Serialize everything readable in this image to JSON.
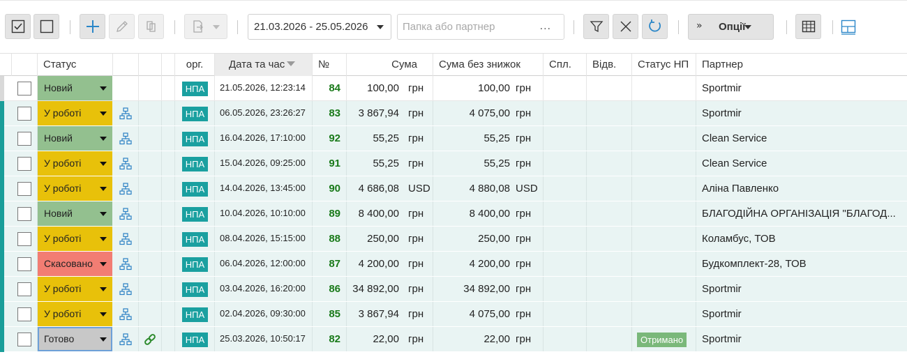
{
  "toolbar": {
    "select_all_icon": "checked-box-icon",
    "deselect_icon": "empty-box-icon",
    "add_icon": "plus-icon",
    "edit_icon": "pencil-icon",
    "copy_icon": "copy-icon",
    "export_icon": "document-export-icon",
    "date_range": "21.03.2026 - 25.05.2026",
    "partner_placeholder": "Папка або партнер",
    "partner_dots": "...",
    "filter_icon": "filter-icon",
    "clear_icon": "close-icon",
    "refresh_icon": "refresh-icon",
    "options_chevrons": "»",
    "options_label": "Опції",
    "table_icon": "table-icon",
    "layout_icon": "layout-icon"
  },
  "columns": {
    "status": "Статус",
    "org": "орг.",
    "datetime": "Дата та час",
    "number": "№",
    "sum": "Сума",
    "sum_no_discount": "Сума без знижок",
    "paid": "Спл.",
    "shipped": "Відв.",
    "np_status": "Статус НП",
    "partner": "Партнер"
  },
  "colors": {
    "new": "#93c08f",
    "in_work": "#e8c10a",
    "cancelled": "#f27d73",
    "done": "#c8c8c8",
    "accent": "#1a9e9a",
    "number": "#1a7a1a"
  },
  "rows": [
    {
      "status": "Новий",
      "status_key": "new",
      "has_tree": false,
      "has_link": false,
      "org": "НПА",
      "datetime": "21.05.2026, 12:23:14",
      "number": "84",
      "sum": "100,00",
      "sum_cur": "грн",
      "sum_nd": "100,00",
      "sum_nd_cur": "грн",
      "np_status": "",
      "partner": "Sportmir"
    },
    {
      "status": "У роботі",
      "status_key": "in_work",
      "has_tree": true,
      "has_link": false,
      "org": "НПА",
      "datetime": "06.05.2026, 23:26:27",
      "number": "83",
      "sum": "3 867,94",
      "sum_cur": "грн",
      "sum_nd": "4 075,00",
      "sum_nd_cur": "грн",
      "np_status": "",
      "partner": "Sportmir"
    },
    {
      "status": "Новий",
      "status_key": "new",
      "has_tree": true,
      "has_link": false,
      "org": "НПА",
      "datetime": "16.04.2026, 17:10:00",
      "number": "92",
      "sum": "55,25",
      "sum_cur": "грн",
      "sum_nd": "55,25",
      "sum_nd_cur": "грн",
      "np_status": "",
      "partner": "Clean Service"
    },
    {
      "status": "У роботі",
      "status_key": "in_work",
      "has_tree": true,
      "has_link": false,
      "org": "НПА",
      "datetime": "15.04.2026, 09:25:00",
      "number": "91",
      "sum": "55,25",
      "sum_cur": "грн",
      "sum_nd": "55,25",
      "sum_nd_cur": "грн",
      "np_status": "",
      "partner": "Clean Service"
    },
    {
      "status": "У роботі",
      "status_key": "in_work",
      "has_tree": true,
      "has_link": false,
      "org": "НПА",
      "datetime": "14.04.2026, 13:45:00",
      "number": "90",
      "sum": "4 686,08",
      "sum_cur": "USD",
      "sum_nd": "4 880,08",
      "sum_nd_cur": "USD",
      "np_status": "",
      "partner": "Аліна Павленко"
    },
    {
      "status": "Новий",
      "status_key": "new",
      "has_tree": true,
      "has_link": false,
      "org": "НПА",
      "datetime": "10.04.2026, 10:10:00",
      "number": "89",
      "sum": "8 400,00",
      "sum_cur": "грн",
      "sum_nd": "8 400,00",
      "sum_nd_cur": "грн",
      "np_status": "",
      "partner": "БЛАГОДІЙНА ОРГАНІЗАЦІЯ \"БЛАГОД..."
    },
    {
      "status": "У роботі",
      "status_key": "in_work",
      "has_tree": true,
      "has_link": false,
      "org": "НПА",
      "datetime": "08.04.2026, 15:15:00",
      "number": "88",
      "sum": "250,00",
      "sum_cur": "грн",
      "sum_nd": "250,00",
      "sum_nd_cur": "грн",
      "np_status": "",
      "partner": "Коламбус, ТОВ"
    },
    {
      "status": "Скасовано",
      "status_key": "cancelled",
      "has_tree": true,
      "has_link": false,
      "org": "НПА",
      "datetime": "06.04.2026, 12:00:00",
      "number": "87",
      "sum": "4 200,00",
      "sum_cur": "грн",
      "sum_nd": "4 200,00",
      "sum_nd_cur": "грн",
      "np_status": "",
      "partner": "Будкомплект-28, ТОВ"
    },
    {
      "status": "У роботі",
      "status_key": "in_work",
      "has_tree": true,
      "has_link": false,
      "org": "НПА",
      "datetime": "03.04.2026, 16:20:00",
      "number": "86",
      "sum": "34 892,00",
      "sum_cur": "грн",
      "sum_nd": "34 892,00",
      "sum_nd_cur": "грн",
      "np_status": "",
      "partner": "Sportmir"
    },
    {
      "status": "У роботі",
      "status_key": "in_work",
      "has_tree": true,
      "has_link": false,
      "org": "НПА",
      "datetime": "02.04.2026, 09:30:00",
      "number": "85",
      "sum": "3 867,94",
      "sum_cur": "грн",
      "sum_nd": "4 075,00",
      "sum_nd_cur": "грн",
      "np_status": "",
      "partner": "Sportmir"
    },
    {
      "status": "Готово",
      "status_key": "done",
      "has_tree": true,
      "has_link": true,
      "org": "НПА",
      "datetime": "25.03.2026, 10:50:17",
      "number": "82",
      "sum": "22,00",
      "sum_cur": "грн",
      "sum_nd": "22,00",
      "sum_nd_cur": "грн",
      "np_status": "Отримано",
      "partner": "Sportmir"
    }
  ]
}
